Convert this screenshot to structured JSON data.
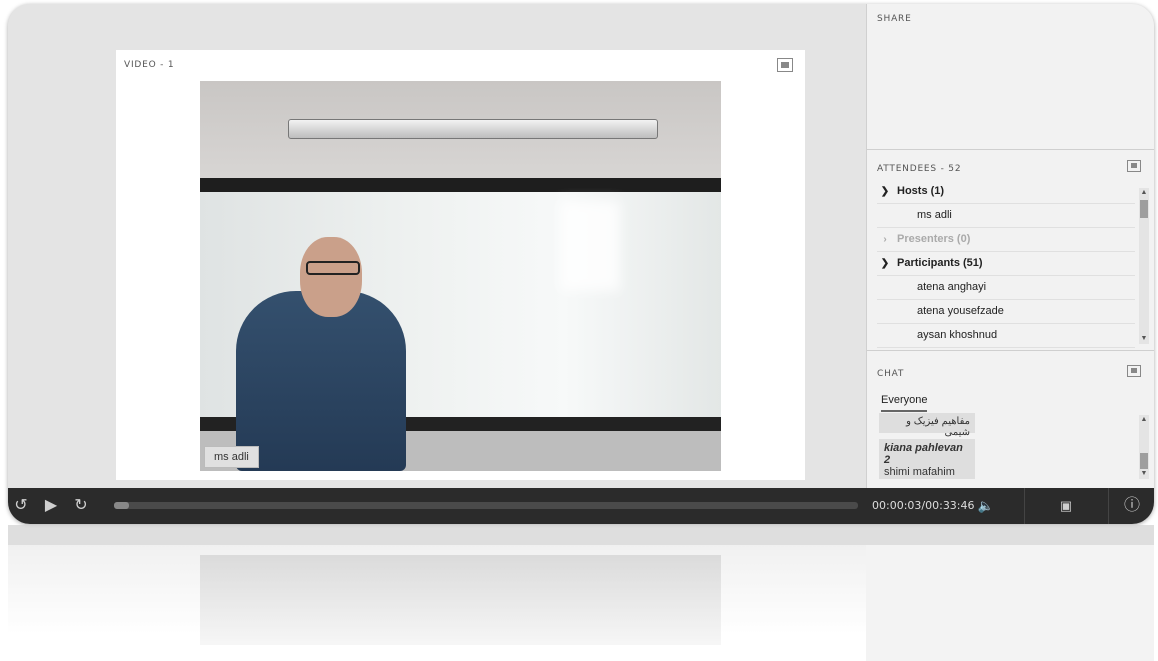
{
  "video_pod": {
    "title": "VIDEO - 1",
    "name_tag": "ms adli"
  },
  "share_pod": {
    "title": "SHARE"
  },
  "attendees_pod": {
    "title": "ATTENDEES - 52",
    "groups": [
      {
        "label": "Hosts (1)",
        "expanded": true,
        "members": [
          "ms adli"
        ]
      },
      {
        "label": "Presenters (0)",
        "expanded": false,
        "members": []
      },
      {
        "label": "Participants (51)",
        "expanded": true,
        "members": [
          "atena anghayi",
          "atena yousefzade",
          "aysan khoshnud"
        ]
      }
    ]
  },
  "chat_pod": {
    "title": "CHAT",
    "tab": "Everyone",
    "messages": [
      {
        "sender": "",
        "text": "مفاهیم فیزیک و شیمی"
      },
      {
        "sender": "kiana pahlevan 2",
        "text": "shimi mafahim"
      }
    ]
  },
  "controls": {
    "time": "00:00:03/00:33:46",
    "progress": 0.0015,
    "icons": [
      "rewind-icon",
      "play-icon",
      "replay-icon",
      "volume-icon",
      "fullscreen-icon",
      "info-icon"
    ]
  }
}
